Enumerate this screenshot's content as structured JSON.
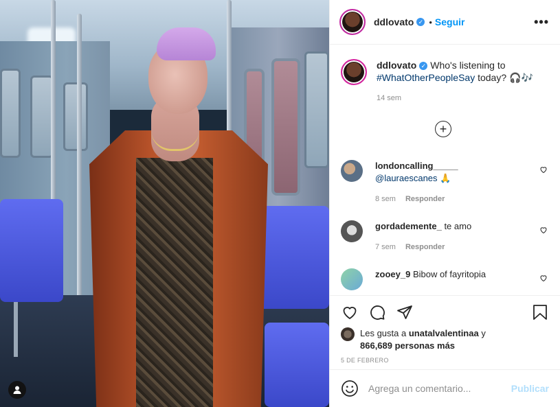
{
  "post": {
    "author": "ddlovato",
    "follow_label": "Seguir",
    "dot": "•",
    "more_label": "•••",
    "caption": {
      "username": "ddlovato",
      "text": "Who's listening to",
      "hashtag": "#WhatOtherPeopleSay",
      "text_after": "today? 🎧🎶",
      "time": "14 sem"
    },
    "load_more_label": "+",
    "comments": [
      {
        "username": "londoncalling_____",
        "text": "@lauraescanes 🙏",
        "time": "8 sem",
        "reply_label": "Responder"
      },
      {
        "username": "gordademente_",
        "text": "te amo",
        "time": "7 sem",
        "reply_label": "Responder"
      },
      {
        "username": "zooey_9",
        "text": "Bibow of fayritopia",
        "time": "",
        "reply_label": ""
      }
    ],
    "likes": {
      "prefix": "Les gusta a",
      "liker": "unatalvalentinaa",
      "conjunction": "y",
      "count": "866,689 personas más"
    },
    "date": "5 DE FEBRERO",
    "add_comment": {
      "placeholder": "Agrega un comentario...",
      "publish_label": "Publicar"
    }
  },
  "colors": {
    "accent": "#0095f6",
    "publish_disabled": "#b2dffc",
    "hashtag": "#00376b",
    "muted": "#8e8e8e"
  },
  "icons": [
    "more-icon",
    "verified-icon",
    "heart-icon",
    "comment-icon",
    "share-icon",
    "save-icon",
    "emoji-icon",
    "user-tag-icon",
    "add-circle-icon"
  ]
}
